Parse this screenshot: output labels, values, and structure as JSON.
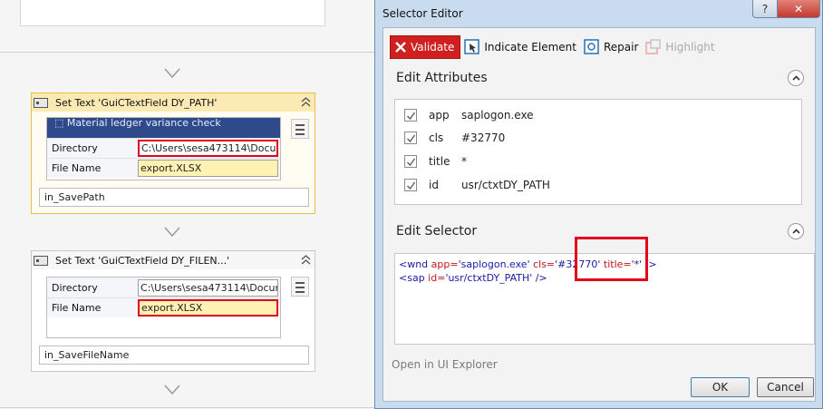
{
  "workflow": {
    "activity1": {
      "title": "Set Text 'GuiCTextField  DY_PATH'",
      "banner": "Material ledger variance check",
      "rows": [
        {
          "label": "Directory",
          "value": "C:\\Users\\sesa473114\\Docum"
        },
        {
          "label": "File Name",
          "value": "export.XLSX"
        }
      ],
      "input_value": "in_SavePath"
    },
    "activity2": {
      "title": "Set Text 'GuiCTextField  DY_FILEN...'",
      "rows": [
        {
          "label": "Directory",
          "value": "C:\\Users\\sesa473114\\Docum"
        },
        {
          "label": "File Name",
          "value": "export.XLSX"
        }
      ],
      "input_value": "in_SaveFileName"
    }
  },
  "dialog": {
    "title": "Selector Editor",
    "help_label": "?",
    "close_label": "✕",
    "toolbar": {
      "validate": "Validate",
      "indicate": "Indicate Element",
      "repair": "Repair",
      "highlight": "Highlight"
    },
    "edit_attributes_title": "Edit Attributes",
    "attributes": [
      {
        "name": "app",
        "value": "saplogon.exe",
        "checked": true
      },
      {
        "name": "cls",
        "value": "#32770",
        "checked": true
      },
      {
        "name": "title",
        "value": "*",
        "checked": true
      },
      {
        "name": "id",
        "value": "usr/ctxtDY_PATH",
        "checked": true
      }
    ],
    "edit_selector_title": "Edit Selector",
    "selector": {
      "line1": {
        "open": "<wnd ",
        "k1": "app=",
        "v1": "'saplogon.exe' ",
        "k2": "cls=",
        "v2": "'#32770' ",
        "k3": "title=",
        "v3": "'*' ",
        "close": "/>"
      },
      "line2": {
        "open": "<sap ",
        "k1": "id=",
        "v1": "'usr/ctxtDY_PATH' ",
        "close": "/>"
      }
    },
    "open_explorer": "Open in UI Explorer",
    "ok": "OK",
    "cancel": "Cancel"
  },
  "colors": {
    "accent_red": "#e2001a",
    "validate_bg": "#d01f1f",
    "selected_activity": "#fbeab3",
    "sap_banner": "#2f4a8a"
  },
  "icons": [
    "chevron-down-icon",
    "collapse-up-icon",
    "set-text-icon",
    "menu-icon",
    "validate-x-icon",
    "indicate-element-icon",
    "repair-icon",
    "highlight-icon",
    "checkbox-check-icon"
  ]
}
